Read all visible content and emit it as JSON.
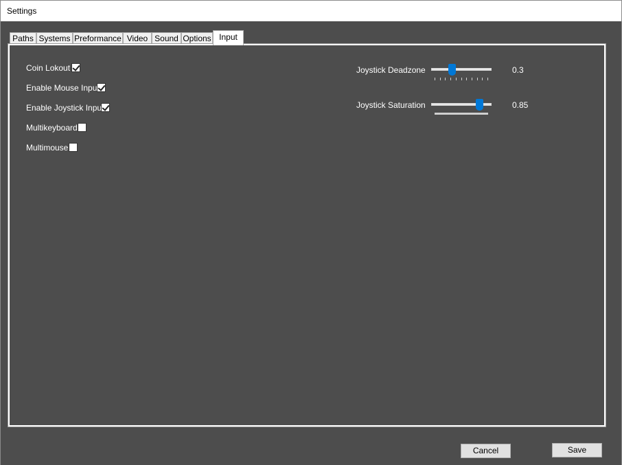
{
  "window": {
    "title": "Settings"
  },
  "tabs": [
    {
      "label": "Paths"
    },
    {
      "label": "Systems"
    },
    {
      "label": "Preformance"
    },
    {
      "label": "Video"
    },
    {
      "label": "Sound"
    },
    {
      "label": "Options"
    },
    {
      "label": "Input",
      "active": true
    }
  ],
  "input": {
    "checkboxes": [
      {
        "label": "Coin Lokout",
        "checked": true
      },
      {
        "label": "Enable Mouse Input",
        "checked": true
      },
      {
        "label": "Enable Joystick Input",
        "checked": true
      },
      {
        "label": "Multikeyboard",
        "checked": false
      },
      {
        "label": "Multimouse",
        "checked": false
      }
    ],
    "sliders": [
      {
        "label": "Joystick Deadzone",
        "value": "0.3",
        "fraction": 0.33
      },
      {
        "label": "Joystick Saturation",
        "value": "0.85",
        "fraction": 0.85
      }
    ]
  },
  "buttons": {
    "cancel": "Cancel",
    "save": "Save"
  },
  "colors": {
    "background": "#4d4d4d",
    "accent": "#0078d7"
  }
}
